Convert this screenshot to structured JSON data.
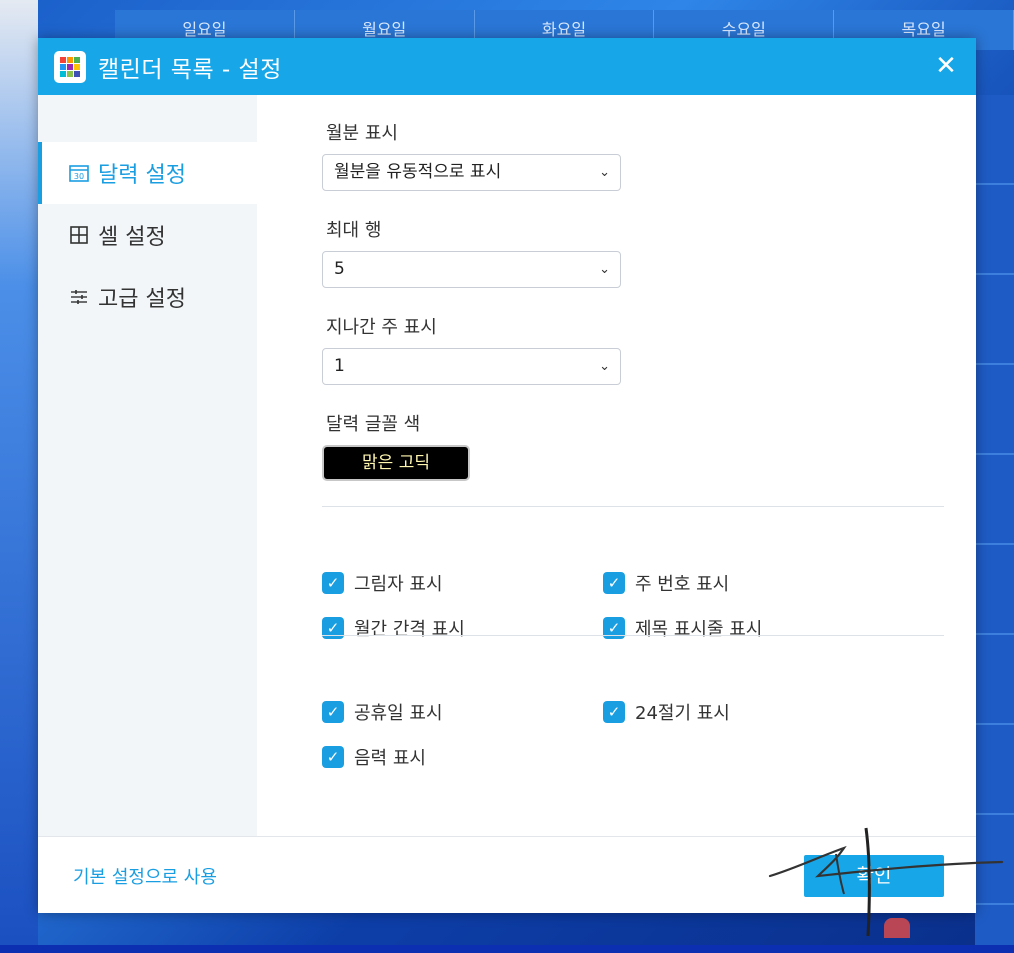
{
  "background": {
    "weekdays": [
      "일요일",
      "월요일",
      "화요일",
      "수요일",
      "목요일"
    ]
  },
  "dialog": {
    "title": "캘린더 목록 - 설정",
    "close_icon": "close-icon",
    "sidebar": {
      "items": [
        {
          "label": "달력 설정",
          "icon": "calendar-icon",
          "active": true
        },
        {
          "label": "셀 설정",
          "icon": "grid-icon",
          "active": false
        },
        {
          "label": "고급 설정",
          "icon": "sliders-icon",
          "active": false
        }
      ]
    },
    "form": {
      "month_display": {
        "label": "월분 표시",
        "value": "월분을 유동적으로 표시"
      },
      "max_rows": {
        "label": "최대 행",
        "value": "5"
      },
      "past_weeks": {
        "label": "지나간 주 표시",
        "value": "1"
      },
      "font_color": {
        "label": "달력 글꼴 색",
        "value": "맑은 고딕"
      }
    },
    "checkboxes_group1": [
      {
        "label": "그림자 표시",
        "checked": true
      },
      {
        "label": "주 번호 표시",
        "checked": true
      },
      {
        "label": "월간 간격 표시",
        "checked": true
      },
      {
        "label": "제목 표시줄 표시",
        "checked": true
      }
    ],
    "checkboxes_group2": [
      {
        "label": "공휴일 표시",
        "checked": true
      },
      {
        "label": "24절기 표시",
        "checked": true
      },
      {
        "label": "음력 표시",
        "checked": true
      }
    ],
    "footer": {
      "reset_label": "기본 설정으로 사용",
      "ok_label": "확인"
    }
  },
  "colors": {
    "accent": "#17a7e8",
    "font_sample_bg": "#000000",
    "font_sample_text": "#fff6b0"
  }
}
